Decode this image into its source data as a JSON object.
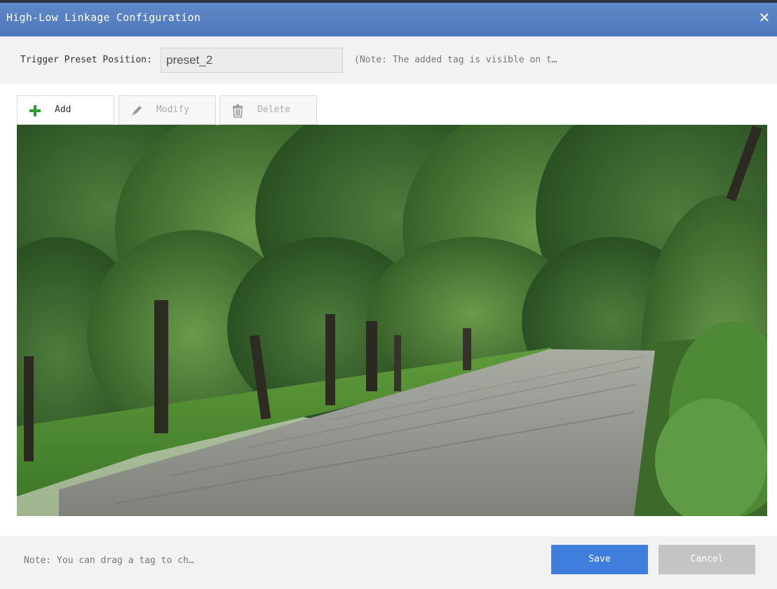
{
  "dialog": {
    "title": "High-Low Linkage Configuration",
    "close_glyph": "✕"
  },
  "trigger": {
    "label": "Trigger Preset Position:",
    "value": "preset_2",
    "note": "(Note: The added tag is visible on t…"
  },
  "toolbar": {
    "add_label": "Add",
    "modify_label": "Modify",
    "delete_label": "Delete",
    "add_icon": "plus-icon",
    "modify_icon": "pencil-icon",
    "delete_icon": "trash-icon"
  },
  "image": {
    "subject": "park path under trees"
  },
  "footer": {
    "note": "Note: You can drag a tag to ch…",
    "save_label": "Save",
    "cancel_label": "Cancel"
  },
  "colors": {
    "titlebar": "#4d78bc",
    "save": "#3f7edc",
    "cancel": "#c4c4c4",
    "add_icon": "#2f9a2f"
  }
}
